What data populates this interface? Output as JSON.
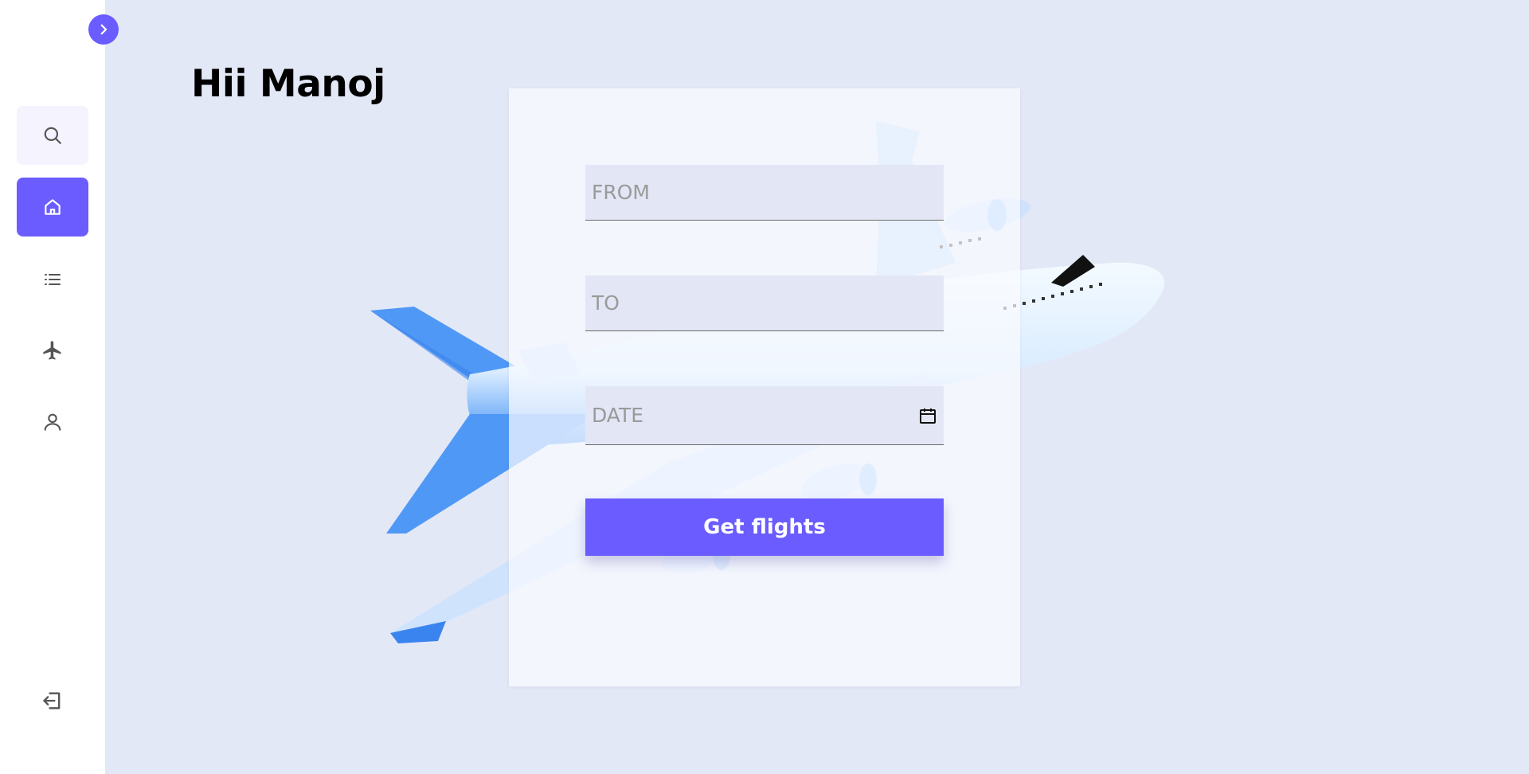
{
  "greeting": "Hii Manoj",
  "sidebar": {
    "toggle_icon": "chevron-right-icon",
    "items": [
      {
        "name": "search",
        "icon": "search-icon",
        "active": false
      },
      {
        "name": "home",
        "icon": "home-icon",
        "active": true
      },
      {
        "name": "list",
        "icon": "list-icon",
        "active": false
      },
      {
        "name": "flights",
        "icon": "airplane-icon",
        "active": false
      },
      {
        "name": "profile",
        "icon": "user-icon",
        "active": false
      }
    ],
    "logout_icon": "logout-icon"
  },
  "form": {
    "from_placeholder": "FROM",
    "to_placeholder": "TO",
    "date_placeholder": "DATE",
    "submit_label": "Get flights"
  },
  "colors": {
    "accent": "#6a5cff",
    "background": "#e3e8f6",
    "sidebar": "#ffffff",
    "plane": "#3d8ef5"
  }
}
